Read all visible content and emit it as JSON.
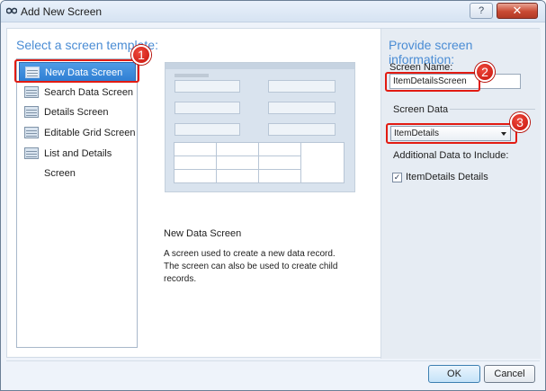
{
  "window": {
    "title": "Add New Screen",
    "help_glyph": "?",
    "close_glyph": "✕"
  },
  "left": {
    "heading": "Select a screen template:",
    "templates": [
      {
        "label": "New Data Screen",
        "icon": "form-icon",
        "selected": true
      },
      {
        "label": "Search Data Screen",
        "icon": "search-grid-icon",
        "selected": false
      },
      {
        "label": "Details Screen",
        "icon": "details-icon",
        "selected": false
      },
      {
        "label": "Editable Grid Screen",
        "icon": "grid-icon",
        "selected": false
      },
      {
        "label": "List and Details Screen",
        "icon": "list-details-icon",
        "selected": false
      }
    ]
  },
  "description": {
    "title": "New Data Screen",
    "text": "A screen used to create a new data record.  The screen can also be used to create child records."
  },
  "right": {
    "heading": "Provide screen information:",
    "screen_name_label": "Screen Name:",
    "screen_name_value": "ItemDetailsScreen",
    "screen_data_label": "Screen Data",
    "screen_data_value": "ItemDetails",
    "additional_label": "Additional Data to Include:",
    "checkbox_label": "ItemDetails Details",
    "checkbox_checked": true,
    "checkbox_glyph": "✓"
  },
  "callouts": [
    "1",
    "2",
    "3"
  ],
  "buttons": {
    "ok": "OK",
    "cancel": "Cancel"
  },
  "colors": {
    "accent_heading": "#4a8cd4",
    "selection": "#3388dd",
    "callout_red": "#d41a12"
  }
}
